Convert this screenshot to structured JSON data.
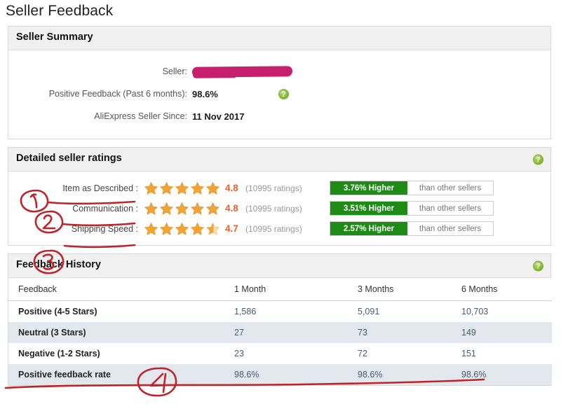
{
  "page": {
    "title": "Seller Feedback"
  },
  "seller_summary": {
    "panel_title": "Seller Summary",
    "rows": [
      {
        "label": "Seller:",
        "value": "",
        "redacted": true
      },
      {
        "label": "Positive Feedback (Past 6 months):",
        "value": "98.6%",
        "help": "?"
      },
      {
        "label": "AliExpress Seller Since:",
        "value": "11 Nov 2017"
      }
    ],
    "help_icon": "?"
  },
  "detailed_seller_ratings": {
    "panel_title": "Detailed seller ratings",
    "help_icon": "?",
    "comparison_suffix": "than other sellers",
    "rows": [
      {
        "label": "Item as Described :",
        "score": "4.8",
        "stars_filled": 5,
        "count": "(10995 ratings)",
        "comparison": "3.76% Higher",
        "comparison_suffix": "than other sellers"
      },
      {
        "label": "Communication :",
        "score": "4.8",
        "stars_filled": 5,
        "count": "(10995 ratings)",
        "comparison": "3.51% Higher",
        "comparison_suffix": "than other sellers"
      },
      {
        "label": "Shipping Speed :",
        "score": "4.7",
        "stars_filled": 4.5,
        "count": "(10995 ratings)",
        "comparison": "2.57% Higher",
        "comparison_suffix": "than other sellers"
      }
    ]
  },
  "feedback_history": {
    "panel_title": "Feedback History",
    "help_icon": "?",
    "columns": [
      "Feedback",
      "1 Month",
      "3 Months",
      "6 Months"
    ],
    "rows": [
      {
        "label": "Positive (4-5 Stars)",
        "values": [
          "1,586",
          "5,091",
          "10,703"
        ]
      },
      {
        "label": "Neutral (3 Stars)",
        "values": [
          "27",
          "73",
          "149"
        ]
      },
      {
        "label": "Negative (1-2 Stars)",
        "values": [
          "23",
          "72",
          "151"
        ]
      },
      {
        "label": "Positive feedback rate",
        "values": [
          "98.6%",
          "98.6%",
          "98.6%"
        ]
      }
    ]
  },
  "annotations": {
    "color": "#c0262b",
    "marks": [
      {
        "number": "1",
        "target": "Item as Described row"
      },
      {
        "number": "2",
        "target": "Communication row"
      },
      {
        "number": "3",
        "target": "Shipping Speed row"
      },
      {
        "number": "4",
        "target": "Positive feedback rate row"
      }
    ]
  },
  "colors": {
    "star": "#f0a030",
    "score": "#e8642c",
    "badge_green": "#1f8b17",
    "redaction": "#c71e6e",
    "annotation_red": "#c0262b",
    "panel_header_bg": "#f1f1f1",
    "table_alt_row": "#e3e8ef"
  }
}
